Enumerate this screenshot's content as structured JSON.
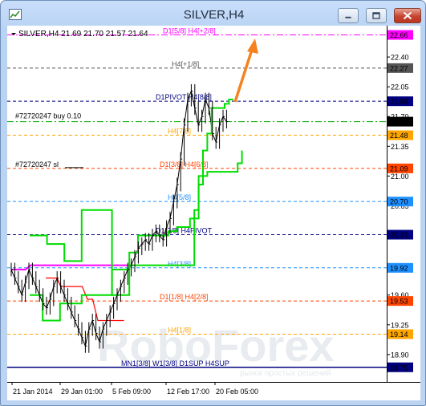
{
  "window": {
    "title": "SILVER,H4",
    "header": "SILVER,H4  21.69 21.70 21.57 21.64"
  },
  "colors": {
    "price": "#000000",
    "channel": "#00dd00",
    "ma_magenta": "#ff00ff",
    "ma_red": "#ff0000",
    "arrow": "#f58220",
    "axis_label_bg": "#000000"
  },
  "chart_data": {
    "type": "line",
    "symbol": "SILVER",
    "timeframe": "H4",
    "ohlc": {
      "open": 21.69,
      "high": 21.7,
      "low": 21.57,
      "close": 21.64
    },
    "ylim": [
      18.71,
      22.75
    ],
    "y_ticks": [
      22.4,
      22.05,
      21.7,
      21.35,
      21.0,
      20.65,
      19.6,
      19.25,
      18.9
    ],
    "x_ticks": [
      "21 Jan 2014",
      "29 Jan 01:00",
      "5 Feb 09:00",
      "12 Feb 17:00",
      "20 Feb 05:00"
    ],
    "levels": [
      {
        "label": "D1[5/8] H4[+2/8]",
        "value": 22.66,
        "price_tag": "22.66",
        "color": "#ff00ff",
        "style": "dashdot"
      },
      {
        "label": "H4[+1/8]",
        "value": 22.27,
        "price_tag": "22.27",
        "color": "#555555",
        "style": "dashed"
      },
      {
        "label": "D1PIVOT H4[8/8]",
        "value": 21.88,
        "price_tag": "21.88",
        "color": "#000080",
        "style": "dashed"
      },
      {
        "label": "#72720247 buy 0.10",
        "value": 21.64,
        "price_tag": "21.64",
        "color": "#00aa00",
        "style": "dashdot"
      },
      {
        "label": "H4[7/8]",
        "value": 21.48,
        "price_tag": "21.48",
        "color": "#ffa500",
        "style": "dashed"
      },
      {
        "label": "D1[3/8] H4[6/8]",
        "value": 21.09,
        "price_tag": "21.09",
        "color": "#ff4500",
        "style": "dashed"
      },
      {
        "label": "H4[5/8]",
        "value": 20.7,
        "price_tag": "20.70",
        "color": "#1e90ff",
        "style": "dashed"
      },
      {
        "label": "D1[2/8] H4PIVOT",
        "value": 20.31,
        "price_tag": "20.31",
        "color": "#000080",
        "style": "dashed"
      },
      {
        "label": "H4[3/8]",
        "value": 19.92,
        "price_tag": "19.92",
        "color": "#1e90ff",
        "style": "dashed"
      },
      {
        "label": "D1[1/8] H4[2/8]",
        "value": 19.53,
        "price_tag": "19.53",
        "color": "#ff4500",
        "style": "dashed"
      },
      {
        "label": "H4[1/8]",
        "value": 19.14,
        "price_tag": "19.14",
        "color": "#ffa500",
        "style": "dashed"
      },
      {
        "label": "MN1[3/8] W1[3/8] D1SUP H4SUP",
        "value": 18.75,
        "price_tag": "18.75",
        "color": "#000080",
        "style": "solid"
      }
    ],
    "order_lines": [
      {
        "label": "#72720247 buy 0.10",
        "value": 21.64
      },
      {
        "label": "#72720247 sl",
        "value": 21.09
      }
    ],
    "watermark": "RoboForex",
    "watermark_tagline": "рынок простых решений",
    "series": [
      {
        "values": [
          19.9,
          19.8,
          19.7,
          19.6,
          19.75,
          19.9,
          19.8,
          19.7,
          19.6,
          19.5,
          19.45,
          19.55,
          19.7,
          19.8,
          19.7,
          19.6,
          19.5,
          19.4,
          19.3,
          19.2,
          19.1,
          19.0,
          19.2,
          19.3,
          19.15,
          19.05,
          19.2,
          19.3,
          19.4,
          19.5,
          19.6,
          19.7,
          19.8,
          19.9,
          19.95,
          20.05,
          20.15,
          20.2,
          20.25,
          20.2,
          20.3,
          20.35,
          20.3,
          20.25,
          20.4,
          20.5,
          20.7,
          20.9,
          21.2,
          21.6,
          21.9,
          22.0,
          21.8,
          21.6,
          21.7,
          21.9,
          21.8,
          21.5,
          21.4,
          21.6,
          21.7,
          21.64
        ]
      },
      {
        "values": [
          19.9,
          19.9,
          19.9,
          19.9,
          19.95,
          19.95,
          19.95,
          19.95,
          19.95,
          19.95,
          19.95,
          19.95,
          19.95,
          19.95,
          19.95,
          19.95,
          19.95,
          19.95,
          19.95,
          19.95,
          19.95,
          19.95,
          19.95,
          19.95,
          19.95,
          19.95
        ]
      },
      {
        "values": [
          19.8,
          19.8,
          19.8,
          19.7,
          19.7,
          19.7,
          19.7,
          19.7,
          19.55,
          19.55,
          19.3,
          19.3,
          19.3,
          19.3,
          19.3,
          19.3
        ]
      },
      {
        "values": [
          20.3,
          20.3,
          20.3,
          20.3,
          20.2,
          20.2,
          20.2,
          20.2,
          20.0,
          20.0,
          20.0,
          20.0,
          20.6,
          20.6,
          20.6,
          20.6,
          20.6,
          20.6,
          20.6,
          19.6,
          19.6,
          19.6,
          19.6,
          20.1,
          20.1,
          20.3,
          20.3,
          20.3,
          20.3,
          20.3,
          20.3,
          20.3,
          20.35,
          20.35,
          20.4,
          20.4,
          20.4,
          20.5,
          20.5,
          21.0,
          21.3,
          21.5,
          21.8,
          21.8,
          21.8,
          21.85,
          21.9,
          21.9
        ]
      },
      {
        "values": [
          19.6,
          19.6,
          19.6,
          19.3,
          19.3,
          19.3,
          19.3,
          19.5,
          19.5,
          19.5,
          19.5,
          19.5,
          19.6,
          19.6,
          19.6,
          19.6,
          19.6,
          19.6,
          19.6,
          19.9,
          19.9,
          19.9,
          19.9,
          19.95,
          19.95,
          19.95,
          19.95,
          19.95,
          19.95,
          19.95,
          19.95,
          19.95,
          19.95,
          19.95,
          19.95,
          19.95,
          19.95,
          19.95,
          20.6,
          20.9,
          21.0,
          21.05,
          21.05,
          21.05,
          21.05,
          21.05,
          21.05,
          21.05,
          21.15,
          21.3
        ]
      }
    ]
  }
}
